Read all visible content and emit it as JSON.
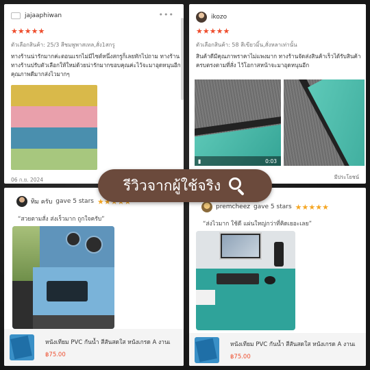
{
  "banner": {
    "text": "รีวิวจากผู้ใช้จริง"
  },
  "reviews": [
    {
      "username": "jajaaphiwan",
      "stars": "★★★★★",
      "variant": "ตัวเลือกสินค้า: 25/3 สีชมพูพาสเทล,สั่ง1สกรู",
      "text": "ทางร้านน่ารักมากค่ะตอนแรกไม่มีไซต์หนึ่งสกรูก็เลยทักไปถาม ทางร้านทางร้านปรับตัวเลือกให้ใหม่ด้วยน่ารักมากขอบคุณค่ะไว้จะมาอุดหนุนอีกคุณภาพดีมากส่งไวมากๆ",
      "date": "06 ก.ย. 2024",
      "swatch_colors": [
        "#d9b94a",
        "#e9a0ab",
        "#4a8fae",
        "#a7c77e"
      ]
    },
    {
      "username": "ikozo",
      "stars": "★★★★★",
      "variant": "ตัวเลือกสินค้า: 58  สีเขียวมิ้น,สั่งหลาเท่านั้น",
      "text": "สินค้าดีมีคุณภาพราคาไม่แพงมาก ทางร้านจัดส่งสินค้าเร็วได้รับสินค้าครบตรงตามที่สั่ง ไว้โอกาสหน้าจะมาอุดหนุนอีก",
      "video_time": "0:03",
      "helpful": "มีประโยชน์"
    },
    {
      "username": "ทิม ครับ",
      "gave": "gave 5 stars",
      "stars": "★★★★★",
      "quote": "“สวยตามสั่ง ส่งเร็วมาก ถูกใจครับ”",
      "product_name": "หนังเทียม PVC กันน้ำ สีสันสดใส หนังเกรด A งานเ",
      "product_price": "฿75.00"
    },
    {
      "username": "premcheez",
      "gave": "gave 5 stars",
      "stars": "★★★★★",
      "quote": "“ส่งไวมาก ใช้ดี แผ่นใหญ่กว่าที่คิดเยอะเลย”",
      "product_name": "หนังเทียม PVC กันน้ำ สีสันสดใส หนังเกรด A งานเ",
      "product_price": "฿75.00"
    }
  ],
  "colors": {
    "accent": "#ee4d2d",
    "banner_bg": "#6b4a3c",
    "teal_fabric": "#2d9d8f",
    "blue_fabric": "#6ea2c6"
  },
  "icons": {
    "more": "more-dots-icon",
    "search": "search-icon"
  }
}
